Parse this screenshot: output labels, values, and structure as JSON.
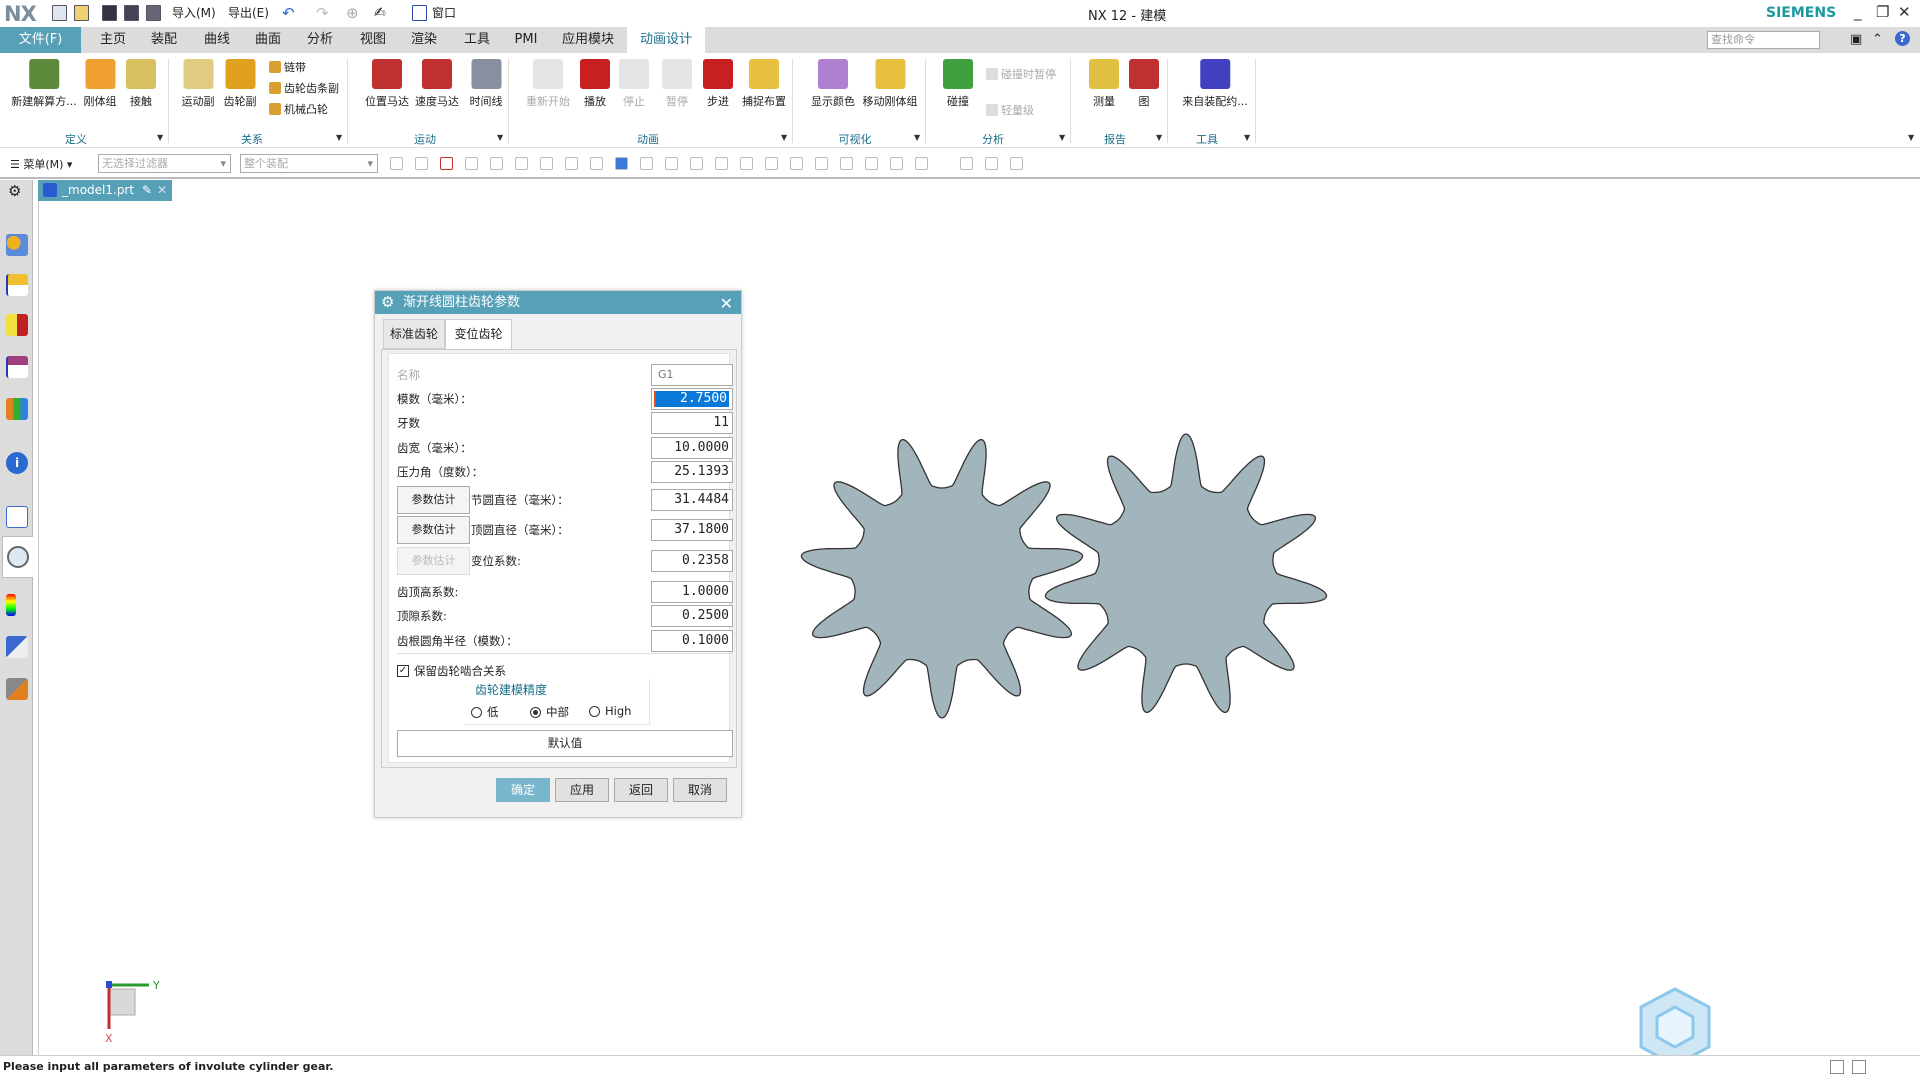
{
  "titlebar": {
    "logo": "NX",
    "import": "导入(M)",
    "export": "导出(E)",
    "window": "窗口",
    "title": "NX 12 - 建模",
    "brand": "SIEMENS"
  },
  "menu": {
    "tabs": [
      "文件(F)",
      "主页",
      "装配",
      "曲线",
      "曲面",
      "分析",
      "视图",
      "渲染",
      "工具",
      "PMI",
      "应用模块",
      "动画设计"
    ],
    "active": "动画设计",
    "search_placeholder": "查找命令"
  },
  "ribbon": {
    "buttons": [
      {
        "label": "新建解算方...",
        "icon": "new-solution-icon",
        "color": "#5a8a3a"
      },
      {
        "label": "刚体组",
        "icon": "rigid-body-icon",
        "color": "#f0a030"
      },
      {
        "label": "接触",
        "icon": "contact-icon",
        "color": "#d8c060"
      },
      {
        "label": "运动副",
        "icon": "joint-icon",
        "color": "#e0cc80"
      },
      {
        "label": "齿轮副",
        "icon": "gear-pair-icon",
        "color": "#e0a020"
      },
      {
        "label": "位置马达",
        "icon": "position-motor-icon",
        "color": "#c03030"
      },
      {
        "label": "速度马达",
        "icon": "speed-motor-icon",
        "color": "#c03030"
      },
      {
        "label": "时间线",
        "icon": "timeline-icon",
        "color": "#8890a0"
      },
      {
        "label": "重新开始",
        "icon": "restart-icon",
        "color": "#ccc",
        "disabled": true
      },
      {
        "label": "播放",
        "icon": "play-icon",
        "color": "#c82020"
      },
      {
        "label": "停止",
        "icon": "stop-icon",
        "color": "#ccc",
        "disabled": true
      },
      {
        "label": "暂停",
        "icon": "pause-icon",
        "color": "#ccc",
        "disabled": true
      },
      {
        "label": "步进",
        "icon": "step-icon",
        "color": "#c82020"
      },
      {
        "label": "捕捉布置",
        "icon": "capture-layout-icon",
        "color": "#e8c040"
      },
      {
        "label": "显示颜色",
        "icon": "display-color-icon",
        "color": "#b080d0"
      },
      {
        "label": "移动刚体组",
        "icon": "move-rigid-body-icon",
        "color": "#e8c040"
      },
      {
        "label": "碰撞",
        "icon": "collision-icon",
        "color": "#40a040"
      },
      {
        "label": "测量",
        "icon": "measure-icon",
        "color": "#e0c040"
      },
      {
        "label": "图",
        "icon": "graph-icon",
        "color": "#c03030"
      },
      {
        "label": "来自装配约...",
        "icon": "from-assembly-icon",
        "color": "#4040c0"
      }
    ],
    "small": [
      {
        "label": "链带",
        "icon": "chain-icon"
      },
      {
        "label": "齿轮齿条副",
        "icon": "rack-pinion-icon"
      },
      {
        "label": "机械凸轮",
        "icon": "cam-icon"
      },
      {
        "label": "碰撞时暂停",
        "icon": "pause-on-collision-icon",
        "disabled": true
      },
      {
        "label": "轻量级",
        "icon": "lightweight-icon",
        "disabled": true
      }
    ],
    "groups": [
      "定义",
      "关系",
      "运动",
      "动画",
      "可视化",
      "分析",
      "报告",
      "工具"
    ]
  },
  "toolbar": {
    "menu": "菜单(M)",
    "filter": "无选择过滤器",
    "scope": "整个装配"
  },
  "doc_tab": "_model1.prt",
  "dialog": {
    "title": "渐开线圆柱齿轮参数",
    "tabs": [
      "标准齿轮",
      "变位齿轮"
    ],
    "active_tab": "变位齿轮",
    "fields": [
      {
        "label": "名称",
        "value": "G1",
        "disabled": true
      },
      {
        "label": "模数（毫米）：",
        "value": "2.7500",
        "selected": true
      },
      {
        "label": "牙数",
        "value": "11"
      },
      {
        "label": "齿宽（毫米）：",
        "value": "10.0000"
      },
      {
        "label": "压力角（度数）：",
        "value": "25.1393"
      },
      {
        "label": "节圆直径（毫米）：",
        "value": "31.4484",
        "estimate": "参数估计"
      },
      {
        "label": "顶圆直径（毫米）：",
        "value": "37.1800",
        "estimate": "参数估计"
      },
      {
        "label": "变位系数:",
        "value": "0.2358",
        "estimate": "参数估计",
        "estimate_disabled": true
      },
      {
        "label": "齿顶高系数:",
        "value": "1.0000"
      },
      {
        "label": "顶隙系数:",
        "value": "0.2500"
      },
      {
        "label": "齿根圆角半径（模数）：",
        "value": "0.1000"
      }
    ],
    "keep_mesh": {
      "label": "保留齿轮啮合关系",
      "checked": true
    },
    "precision": {
      "title": "齿轮建模精度",
      "options": [
        "低",
        "中部",
        "High"
      ],
      "selected": "中部"
    },
    "default_button": "默认值",
    "buttons": [
      "确定",
      "应用",
      "返回",
      "取消"
    ]
  },
  "viewport": {
    "gear_teeth": 11,
    "gear_count": 2,
    "gear_fill": "#a3b5bc",
    "triad": {
      "x": "X",
      "y": "Y"
    }
  },
  "status": "Please input all parameters of involute cylinder gear.",
  "colors": {
    "accent": "#56a0b8",
    "ribbon_label": "#1a6f8c",
    "selection": "#0a78d7"
  }
}
